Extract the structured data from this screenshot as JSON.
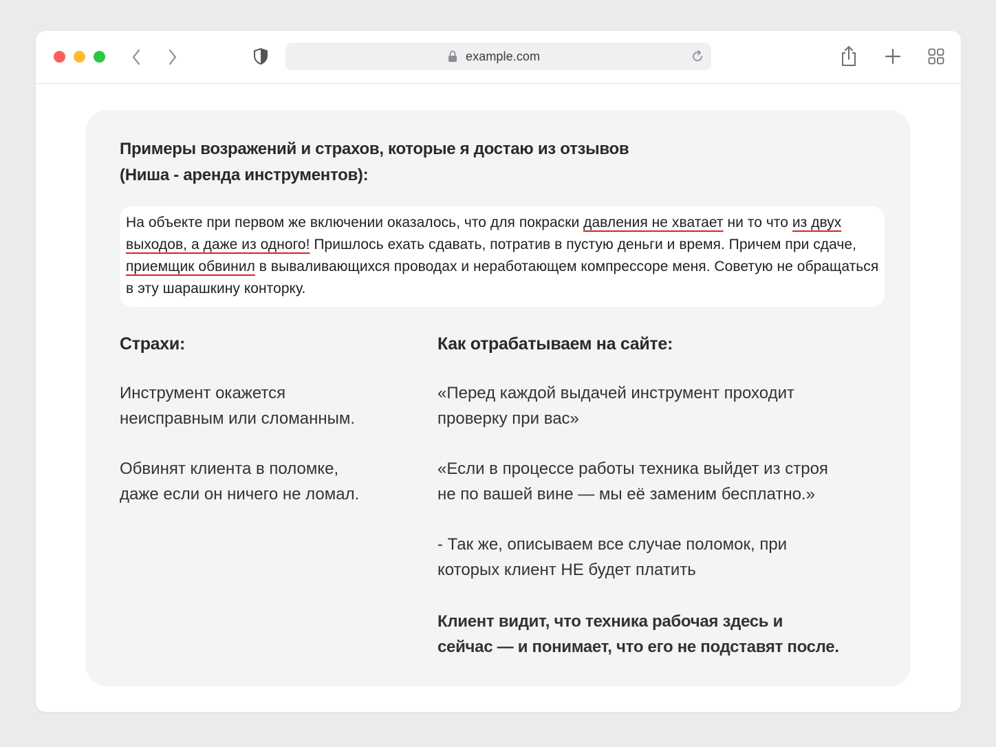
{
  "browser": {
    "url": "example.com",
    "icons": {
      "back": "chevron-left-icon",
      "forward": "chevron-right-icon",
      "privacy": "shield-icon",
      "lock": "lock-icon",
      "reload": "reload-icon",
      "share": "share-icon",
      "new_tab": "plus-icon",
      "tabs": "tab-grid-icon"
    },
    "traffic_lights": {
      "close": "#fe5f57",
      "minimize": "#febc2e",
      "zoom": "#28c840"
    }
  },
  "card": {
    "heading_line1": "Примеры возражений и страхов, которые я достаю из отзывов",
    "heading_line2": "(Ниша - аренда инструментов):",
    "review": {
      "p1": "На объекте при первом же включении оказалось, что для покраски ",
      "u1": "давления не хватает",
      "p2": " ни то что ",
      "u2": "из двух выходов, а даже из одного!",
      "p3": " Пришлось ехать сдавать, потратив в пустую деньги и время. Причем при сдаче, ",
      "u3": "приемщик обвинил",
      "p4": " в вываливающихся проводах и неработающем компрессоре меня. Советую не обращаться в эту шарашкину конторку.",
      "underline_color": "#e02020"
    },
    "fears": {
      "title": "Страхи:",
      "items": [
        {
          "line1": "Инструмент окажется",
          "line2": "неисправным или сломанным."
        },
        {
          "line1": "Обвинят клиента в поломке,",
          "line2": "даже если он ничего не ломал."
        }
      ]
    },
    "handling": {
      "title": "Как отрабатываем на сайте:",
      "items": [
        {
          "line1": "«Перед каждой выдачей инструмент проходит",
          "line2": "проверку при вас»"
        },
        {
          "line1": "«Если в процессе работы техника выйдет из строя",
          "line2": "не по вашей вине — мы её заменим бесплатно.»"
        },
        {
          "line1": "- Так же, описываем все случае поломок, при",
          "line2": "которых клиент НЕ будет платить"
        }
      ],
      "conclusion_line1": "Клиент видит, что техника рабочая здесь и",
      "conclusion_line2": "сейчас — и понимает, что его не подставят после."
    }
  }
}
